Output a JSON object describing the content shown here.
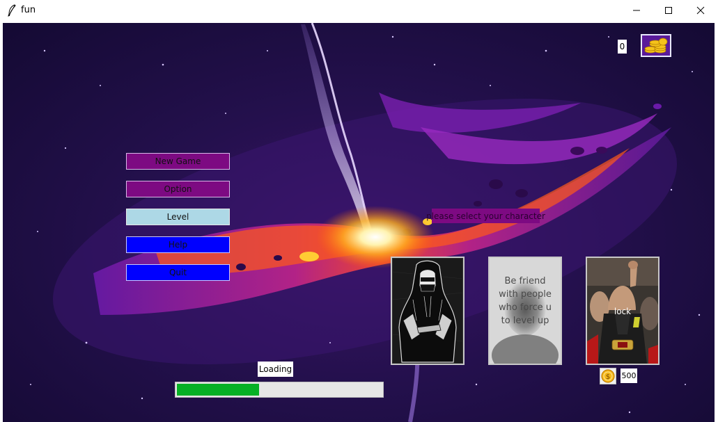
{
  "window": {
    "title": "fun"
  },
  "menu": {
    "new_game": "New Game",
    "option": "Option",
    "level": "Level",
    "help": "Help",
    "quit": "Quit"
  },
  "coins": {
    "count": "0"
  },
  "character_select": {
    "prompt": "please select your character",
    "cards": [
      {
        "id": "hooded-figure"
      },
      {
        "id": "motivational-figure",
        "overlay_text": [
          "Be friend",
          "with people",
          "who force u",
          "to level up"
        ]
      },
      {
        "id": "fighter",
        "overlay_text": [
          "lock"
        ],
        "price": "500"
      }
    ]
  },
  "loading": {
    "label": "Loading",
    "progress": 0.4
  },
  "colors": {
    "menu_purple": "#7d0a82",
    "menu_light": "#add8e6",
    "menu_blue": "#0000ff",
    "progress_green": "#06b025"
  },
  "icons": {
    "title_icon": "feather-icon",
    "coin_stack": "gold-coin-stack-icon",
    "coin": "gold-coin-icon"
  }
}
